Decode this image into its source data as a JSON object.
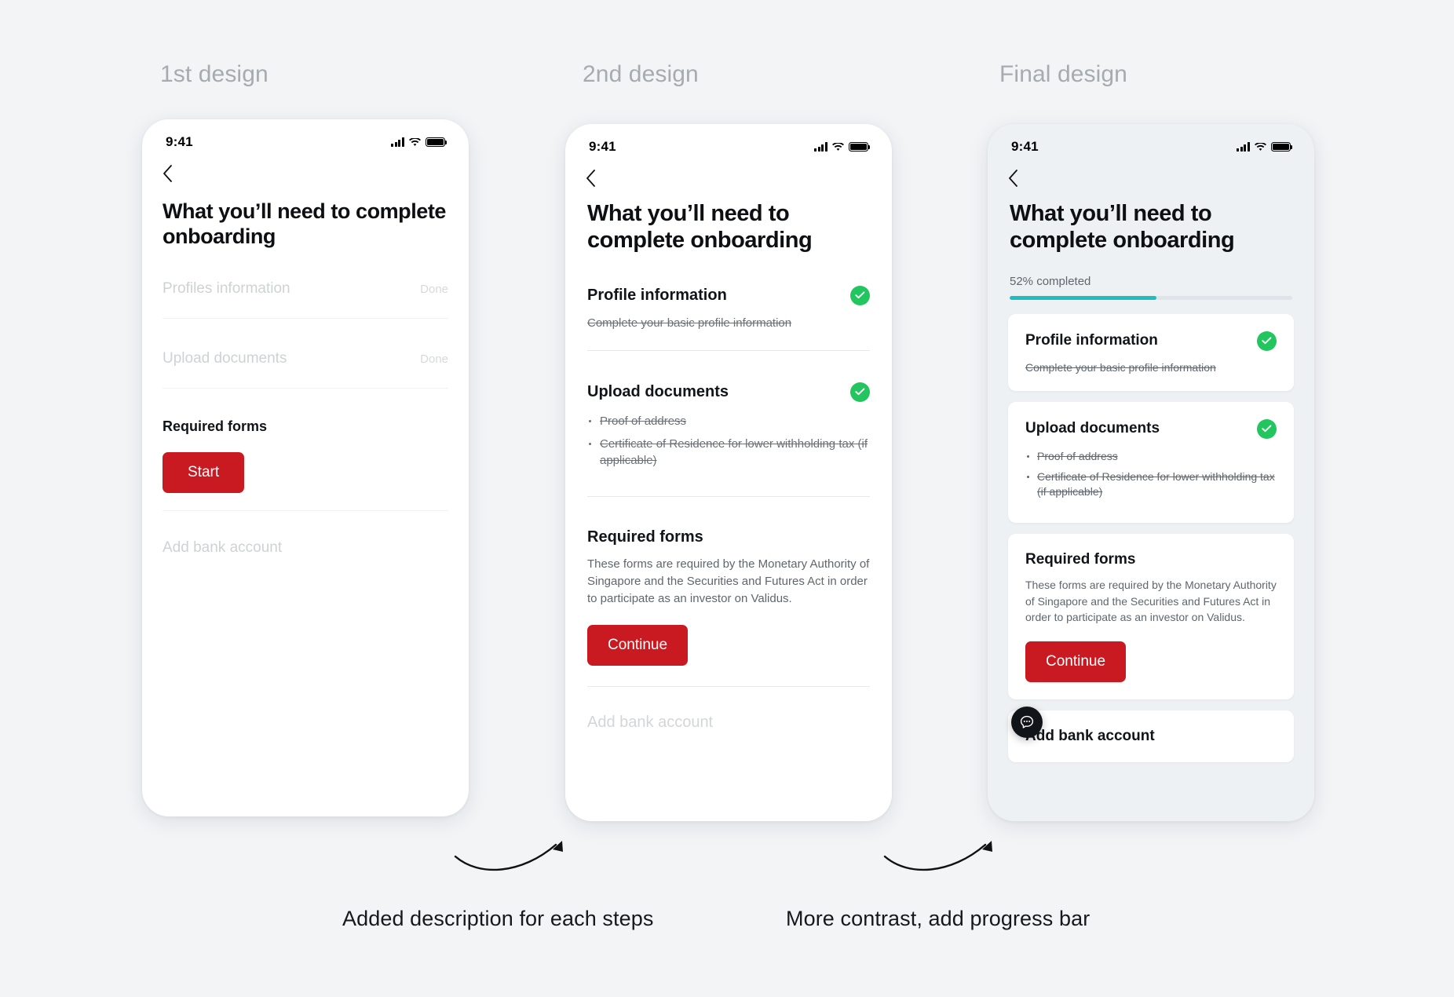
{
  "columns": [
    {
      "label": "1st design"
    },
    {
      "label": "2nd design"
    },
    {
      "label": "Final design"
    }
  ],
  "status_bar": {
    "time": "9:41"
  },
  "common": {
    "title": "What you’ll need to complete onboarding",
    "back_icon": "chevron-left-icon",
    "cellular_icon": "cellular-signal-icon",
    "wifi_icon": "wifi-icon",
    "battery_icon": "battery-full-icon"
  },
  "design1": {
    "rows": [
      {
        "title": "Profiles information",
        "status": "Done"
      },
      {
        "title": "Upload documents",
        "status": "Done"
      }
    ],
    "required_forms_title": "Required forms",
    "start_button": "Start",
    "add_bank_account": "Add bank account"
  },
  "design2": {
    "sections": [
      {
        "title": "Profile information",
        "subtitle": "Complete your basic profile information",
        "done": true
      },
      {
        "title": "Upload documents",
        "items": [
          "Proof of address",
          "Certificate of Residence for lower withholding tax (if applicable)"
        ],
        "done": true
      },
      {
        "title": "Required forms",
        "paragraph": "These forms are required by the Monetary Authority of Singapore and the Securities and Futures Act in order to participate as an investor on Validus.",
        "button": "Continue",
        "done": false
      }
    ],
    "add_bank_account": "Add bank account"
  },
  "design3": {
    "progress_label": "52% completed",
    "progress_percent": 52,
    "progress_color": "#21bcc0",
    "progress_track_color": "#dfe3ea",
    "cards": [
      {
        "title": "Profile information",
        "subtitle": "Complete your basic profile information",
        "done": true
      },
      {
        "title": "Upload documents",
        "items": [
          "Proof of address",
          "Certificate of Residence for lower withholding tax (if applicable)"
        ],
        "done": true
      },
      {
        "title": "Required forms",
        "paragraph": "These forms are required by the Monetary Authority of Singapore and the Securities and Futures Act in order to participate as an investor on Validus.",
        "button": "Continue",
        "done": false
      },
      {
        "title": "Add bank account",
        "done": false
      }
    ],
    "chat_icon": "chat-bubble-icon"
  },
  "annotations": [
    {
      "text": "Added description for each steps",
      "arrow_icon": "curved-arrow-icon"
    },
    {
      "text": "More contrast, add progress bar",
      "arrow_icon": "curved-arrow-icon"
    }
  ],
  "colors": {
    "accent_red": "#ca1a21",
    "success_green": "#22c55e",
    "progress_teal": "#21bcc0",
    "page_background": "#f2f4f6"
  }
}
